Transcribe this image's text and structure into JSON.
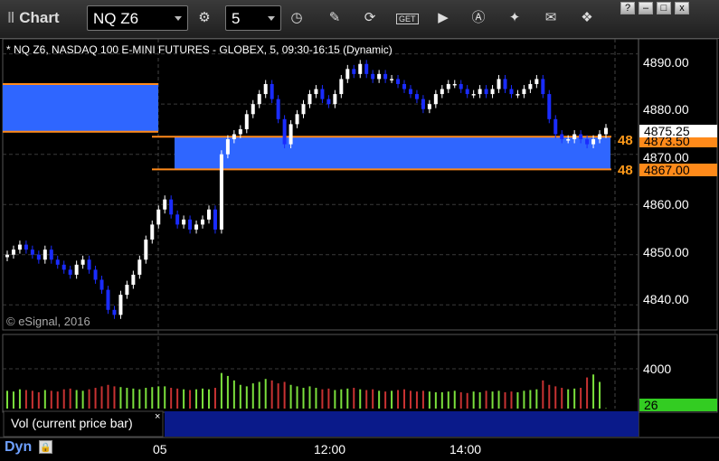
{
  "toolbar": {
    "title": "Chart",
    "symbol": "NQ Z6",
    "interval": "5",
    "window_buttons": [
      "?",
      "–",
      "□",
      "x"
    ]
  },
  "chart": {
    "description": "* NQ Z6, NASDAQ 100 E-MINI FUTURES - GLOBEX, 5, 09:30-16:15 (Dynamic)",
    "copyright": "© eSignal, 2016",
    "price_ticks": [
      "4890.00",
      "4880.00",
      "4870.00",
      "4860.00",
      "4850.00",
      "4840.00"
    ],
    "time_ticks": [
      "05",
      "12:00",
      "14:00"
    ],
    "last_price": "4875.25",
    "level_upper": "4873.50",
    "level_lower": "4867.00",
    "level_marker_upper": "48",
    "level_marker_lower": "48",
    "volume_tick": "4000",
    "volume_current": "26",
    "volume_label": "Vol (current price bar)",
    "volume_close": "×",
    "mode": "Dyn",
    "colors": {
      "zone": "#2f66ff",
      "zone_line": "#ff8a1a",
      "candle_up": "#ffffff",
      "candle_down": "#1a2cff",
      "vol_up": "#7be03c",
      "vol_down": "#c83232",
      "last_price_bg": "#ffffff",
      "level_bg": "#ff8a1a",
      "vol_current_bg": "#33cc22"
    }
  },
  "chart_data": {
    "type": "candlestick",
    "price_axis": {
      "min": 4835,
      "max": 4893,
      "ticks": [
        4840,
        4850,
        4860,
        4870,
        4880,
        4890
      ]
    },
    "zones": [
      {
        "session": "prior",
        "low": 4874.5,
        "high": 4884
      },
      {
        "session": "current",
        "low": 4867,
        "high": 4873.5
      }
    ],
    "closes": [
      4850,
      4851,
      4852,
      4851,
      4850,
      4849,
      4851,
      4849,
      4848,
      4847,
      4846,
      4848,
      4849,
      4847,
      4845,
      4843,
      4839,
      4838,
      4842,
      4844,
      4846,
      4849,
      4853,
      4856,
      4859,
      4861,
      4858,
      4856,
      4857,
      4855,
      4856,
      4857,
      4859,
      4855,
      4870,
      4873,
      4874,
      4875,
      4878,
      4880,
      4882,
      4884,
      4881,
      4877,
      4872,
      4876,
      4878,
      4880,
      4882,
      4883,
      4881,
      4880,
      4882,
      4885,
      4887,
      4886,
      4888,
      4886,
      4885,
      4886,
      4885,
      4885,
      4884,
      4883,
      4882,
      4881,
      4879,
      4880,
      4882,
      4883,
      4884,
      4884,
      4883,
      4882,
      4882,
      4883,
      4882,
      4883,
      4885,
      4883,
      4882,
      4882,
      4883,
      4884,
      4885,
      4882,
      4877,
      4874,
      4873,
      4873,
      4874,
      4873,
      4872,
      4873,
      4874,
      4875.25
    ],
    "volumes": [
      1200,
      1150,
      1300,
      1250,
      1200,
      1100,
      1250,
      1200,
      1150,
      1300,
      1350,
      1250,
      1200,
      1300,
      1400,
      1500,
      1600,
      1500,
      1450,
      1400,
      1350,
      1300,
      1400,
      1450,
      1500,
      1500,
      1400,
      1350,
      1300,
      1250,
      1300,
      1350,
      1300,
      1400,
      2400,
      2200,
      1900,
      1600,
      1500,
      1700,
      1800,
      2000,
      1900,
      1700,
      1800,
      1600,
      1500,
      1400,
      1500,
      1400,
      1300,
      1350,
      1250,
      1300,
      1350,
      1400,
      1300,
      1250,
      1300,
      1200,
      1150,
      1200,
      1250,
      1300,
      1200,
      1150,
      1200,
      1150,
      1100,
      1100,
      1150,
      1200,
      1100,
      1050,
      1150,
      1100,
      1200,
      1150,
      1200,
      1100,
      1150,
      1100,
      1200,
      1250,
      1300,
      1900,
      1600,
      1500,
      1400,
      1300,
      1350,
      1400,
      2100,
      2300,
      1800,
      26
    ],
    "volume_axis": {
      "max": 5000,
      "ticks": [
        4000
      ]
    }
  }
}
